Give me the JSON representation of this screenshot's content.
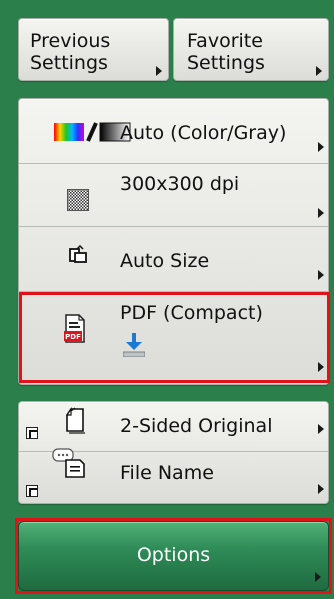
{
  "top_buttons": {
    "previous_settings": [
      "Previous",
      "Settings"
    ],
    "favorite_settings": [
      "Favorite",
      "Settings"
    ]
  },
  "settings": {
    "color_mode": "Auto (Color/Gray)",
    "resolution": "300x300 dpi",
    "scan_size": "Auto Size",
    "file_format": "PDF (Compact)"
  },
  "extra": {
    "two_sided": "2-Sided Original",
    "file_name": "File Name"
  },
  "options_label": "Options",
  "icons": {
    "color_mode": "color-gray-icon",
    "resolution": "resolution-pattern-icon",
    "scan_size": "auto-size-icon",
    "file_format": "pdf-file-icon",
    "two_sided": "two-sided-original-icon",
    "file_name": "file-name-icon",
    "shortcut": "shortcut-arrow-icon"
  },
  "colors": {
    "background": "#2a7f4a",
    "highlight": "#e0121a",
    "options_button": "#2e8b57"
  }
}
